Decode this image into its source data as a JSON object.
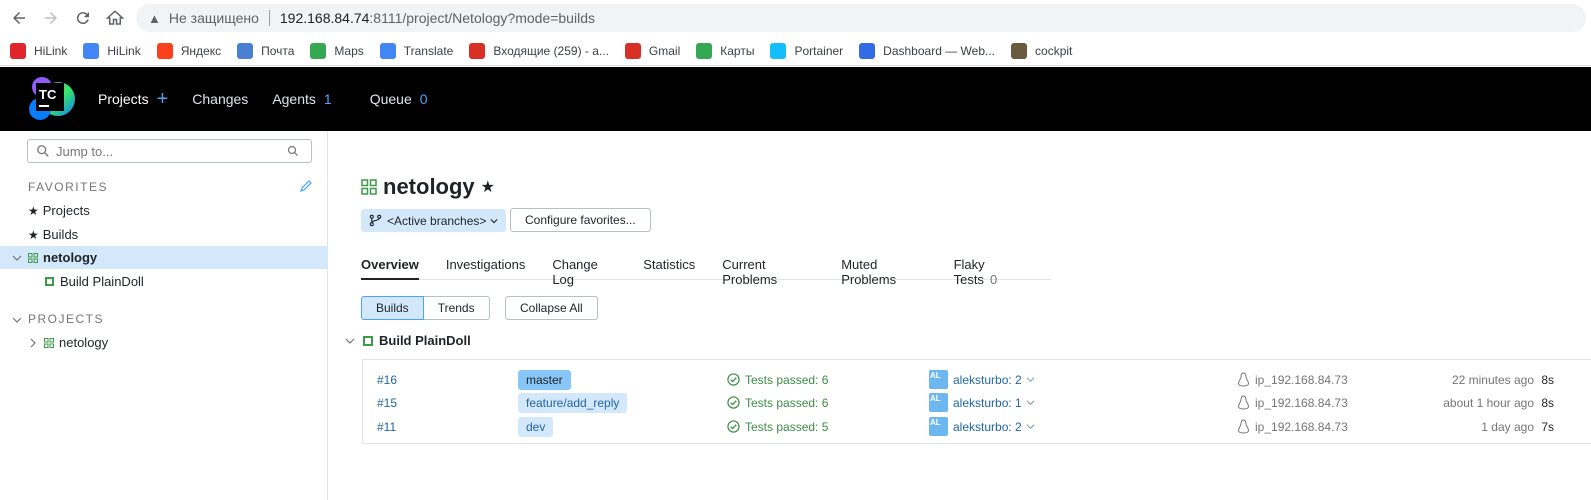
{
  "browser": {
    "security_text": "Не защищено",
    "url_host": "192.168.84.74",
    "url_path": ":8111/project/Netology?mode=builds",
    "bookmarks": [
      {
        "label": "HiLink",
        "icon": "huawei-icon",
        "color": "#e0262b"
      },
      {
        "label": "HiLink",
        "icon": "google-icon",
        "color": "#4285f4"
      },
      {
        "label": "Яндекс",
        "icon": "yandex-icon",
        "color": "#fc3f1d"
      },
      {
        "label": "Почта",
        "icon": "mail-icon",
        "color": "#4a7fd1"
      },
      {
        "label": "Maps",
        "icon": "maps-icon",
        "color": "#34a853"
      },
      {
        "label": "Translate",
        "icon": "translate-icon",
        "color": "#4285f4"
      },
      {
        "label": "Входящие (259) - a...",
        "icon": "gmail-icon",
        "color": "#d93025"
      },
      {
        "label": "Gmail",
        "icon": "gmail-icon",
        "color": "#d93025"
      },
      {
        "label": "Карты",
        "icon": "maps-icon",
        "color": "#34a853"
      },
      {
        "label": "Portainer",
        "icon": "portainer-icon",
        "color": "#13bef9"
      },
      {
        "label": "Dashboard — Web...",
        "icon": "kubernetes-icon",
        "color": "#326ce5"
      },
      {
        "label": "cockpit",
        "icon": "cockpit-icon",
        "color": "#6b5b3e"
      }
    ]
  },
  "header": {
    "logo_text": "TC",
    "projects": "Projects",
    "changes": "Changes",
    "agents": "Agents",
    "agents_count": "1",
    "queue": "Queue",
    "queue_count": "0"
  },
  "sidebar": {
    "search_placeholder": "Jump to...",
    "favorites_title": "FAVORITES",
    "fav_projects": "Projects",
    "fav_builds": "Builds",
    "fav_netology": "netology",
    "fav_build_plaindoll": "Build PlainDoll",
    "projects_title": "PROJECTS",
    "proj_netology": "netology"
  },
  "main": {
    "title": "netology",
    "branch_selector": "<Active branches>",
    "configure_favorites": "Configure favorites...",
    "tabs": [
      {
        "label": "Overview"
      },
      {
        "label": "Investigations"
      },
      {
        "label": "Change Log"
      },
      {
        "label": "Statistics"
      },
      {
        "label": "Current Problems"
      },
      {
        "label": "Muted Problems"
      },
      {
        "label": "Flaky Tests",
        "count": "0"
      }
    ],
    "builds_btn": "Builds",
    "trends_btn": "Trends",
    "collapse_all": "Collapse All",
    "build_type": "Build PlainDoll",
    "builds": [
      {
        "number": "#16",
        "branch": "master",
        "status": "Tests passed: 6",
        "avatar": "AL",
        "user": "aleksturbo: 2",
        "agent": "ip_192.168.84.73",
        "when": "22 minutes ago",
        "duration": "8s"
      },
      {
        "number": "#15",
        "branch": "feature/add_reply",
        "status": "Tests passed: 6",
        "avatar": "AL",
        "user": "aleksturbo: 1",
        "agent": "ip_192.168.84.73",
        "when": "about 1 hour ago",
        "duration": "8s"
      },
      {
        "number": "#11",
        "branch": "dev",
        "status": "Tests passed: 5",
        "avatar": "AL",
        "user": "aleksturbo: 2",
        "agent": "ip_192.168.84.73",
        "when": "1 day ago",
        "duration": "7s"
      }
    ]
  }
}
